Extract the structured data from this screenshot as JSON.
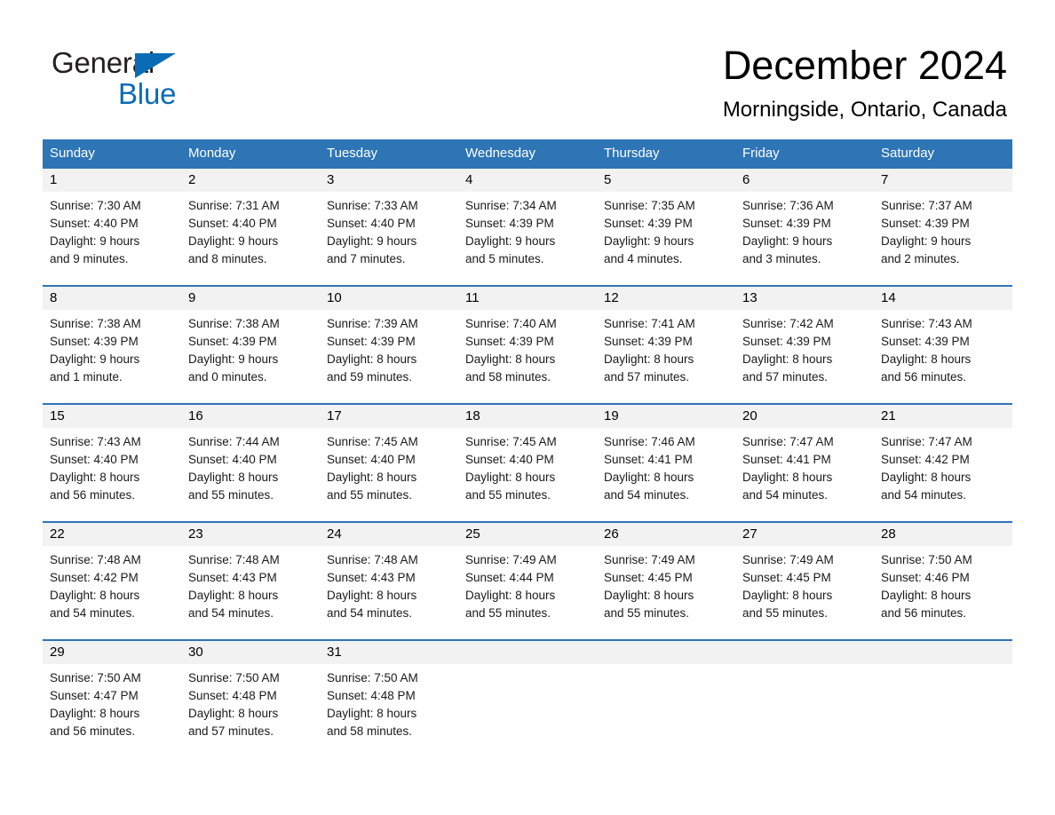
{
  "brand": {
    "name_part1": "General",
    "name_part2": "Blue",
    "accent_color": "#0a6cb4"
  },
  "header": {
    "title": "December 2024",
    "subtitle": "Morningside, Ontario, Canada"
  },
  "theme": {
    "header_bar_color": "#2e75b6",
    "day_band_color": "#f2f2f2",
    "text_color": "#000000"
  },
  "weekdays": [
    "Sunday",
    "Monday",
    "Tuesday",
    "Wednesday",
    "Thursday",
    "Friday",
    "Saturday"
  ],
  "weeks": [
    [
      {
        "day": "1",
        "sunrise": "Sunrise: 7:30 AM",
        "sunset": "Sunset: 4:40 PM",
        "daylight_line1": "Daylight: 9 hours",
        "daylight_line2": "and 9 minutes."
      },
      {
        "day": "2",
        "sunrise": "Sunrise: 7:31 AM",
        "sunset": "Sunset: 4:40 PM",
        "daylight_line1": "Daylight: 9 hours",
        "daylight_line2": "and 8 minutes."
      },
      {
        "day": "3",
        "sunrise": "Sunrise: 7:33 AM",
        "sunset": "Sunset: 4:40 PM",
        "daylight_line1": "Daylight: 9 hours",
        "daylight_line2": "and 7 minutes."
      },
      {
        "day": "4",
        "sunrise": "Sunrise: 7:34 AM",
        "sunset": "Sunset: 4:39 PM",
        "daylight_line1": "Daylight: 9 hours",
        "daylight_line2": "and 5 minutes."
      },
      {
        "day": "5",
        "sunrise": "Sunrise: 7:35 AM",
        "sunset": "Sunset: 4:39 PM",
        "daylight_line1": "Daylight: 9 hours",
        "daylight_line2": "and 4 minutes."
      },
      {
        "day": "6",
        "sunrise": "Sunrise: 7:36 AM",
        "sunset": "Sunset: 4:39 PM",
        "daylight_line1": "Daylight: 9 hours",
        "daylight_line2": "and 3 minutes."
      },
      {
        "day": "7",
        "sunrise": "Sunrise: 7:37 AM",
        "sunset": "Sunset: 4:39 PM",
        "daylight_line1": "Daylight: 9 hours",
        "daylight_line2": "and 2 minutes."
      }
    ],
    [
      {
        "day": "8",
        "sunrise": "Sunrise: 7:38 AM",
        "sunset": "Sunset: 4:39 PM",
        "daylight_line1": "Daylight: 9 hours",
        "daylight_line2": "and 1 minute."
      },
      {
        "day": "9",
        "sunrise": "Sunrise: 7:38 AM",
        "sunset": "Sunset: 4:39 PM",
        "daylight_line1": "Daylight: 9 hours",
        "daylight_line2": "and 0 minutes."
      },
      {
        "day": "10",
        "sunrise": "Sunrise: 7:39 AM",
        "sunset": "Sunset: 4:39 PM",
        "daylight_line1": "Daylight: 8 hours",
        "daylight_line2": "and 59 minutes."
      },
      {
        "day": "11",
        "sunrise": "Sunrise: 7:40 AM",
        "sunset": "Sunset: 4:39 PM",
        "daylight_line1": "Daylight: 8 hours",
        "daylight_line2": "and 58 minutes."
      },
      {
        "day": "12",
        "sunrise": "Sunrise: 7:41 AM",
        "sunset": "Sunset: 4:39 PM",
        "daylight_line1": "Daylight: 8 hours",
        "daylight_line2": "and 57 minutes."
      },
      {
        "day": "13",
        "sunrise": "Sunrise: 7:42 AM",
        "sunset": "Sunset: 4:39 PM",
        "daylight_line1": "Daylight: 8 hours",
        "daylight_line2": "and 57 minutes."
      },
      {
        "day": "14",
        "sunrise": "Sunrise: 7:43 AM",
        "sunset": "Sunset: 4:39 PM",
        "daylight_line1": "Daylight: 8 hours",
        "daylight_line2": "and 56 minutes."
      }
    ],
    [
      {
        "day": "15",
        "sunrise": "Sunrise: 7:43 AM",
        "sunset": "Sunset: 4:40 PM",
        "daylight_line1": "Daylight: 8 hours",
        "daylight_line2": "and 56 minutes."
      },
      {
        "day": "16",
        "sunrise": "Sunrise: 7:44 AM",
        "sunset": "Sunset: 4:40 PM",
        "daylight_line1": "Daylight: 8 hours",
        "daylight_line2": "and 55 minutes."
      },
      {
        "day": "17",
        "sunrise": "Sunrise: 7:45 AM",
        "sunset": "Sunset: 4:40 PM",
        "daylight_line1": "Daylight: 8 hours",
        "daylight_line2": "and 55 minutes."
      },
      {
        "day": "18",
        "sunrise": "Sunrise: 7:45 AM",
        "sunset": "Sunset: 4:40 PM",
        "daylight_line1": "Daylight: 8 hours",
        "daylight_line2": "and 55 minutes."
      },
      {
        "day": "19",
        "sunrise": "Sunrise: 7:46 AM",
        "sunset": "Sunset: 4:41 PM",
        "daylight_line1": "Daylight: 8 hours",
        "daylight_line2": "and 54 minutes."
      },
      {
        "day": "20",
        "sunrise": "Sunrise: 7:47 AM",
        "sunset": "Sunset: 4:41 PM",
        "daylight_line1": "Daylight: 8 hours",
        "daylight_line2": "and 54 minutes."
      },
      {
        "day": "21",
        "sunrise": "Sunrise: 7:47 AM",
        "sunset": "Sunset: 4:42 PM",
        "daylight_line1": "Daylight: 8 hours",
        "daylight_line2": "and 54 minutes."
      }
    ],
    [
      {
        "day": "22",
        "sunrise": "Sunrise: 7:48 AM",
        "sunset": "Sunset: 4:42 PM",
        "daylight_line1": "Daylight: 8 hours",
        "daylight_line2": "and 54 minutes."
      },
      {
        "day": "23",
        "sunrise": "Sunrise: 7:48 AM",
        "sunset": "Sunset: 4:43 PM",
        "daylight_line1": "Daylight: 8 hours",
        "daylight_line2": "and 54 minutes."
      },
      {
        "day": "24",
        "sunrise": "Sunrise: 7:48 AM",
        "sunset": "Sunset: 4:43 PM",
        "daylight_line1": "Daylight: 8 hours",
        "daylight_line2": "and 54 minutes."
      },
      {
        "day": "25",
        "sunrise": "Sunrise: 7:49 AM",
        "sunset": "Sunset: 4:44 PM",
        "daylight_line1": "Daylight: 8 hours",
        "daylight_line2": "and 55 minutes."
      },
      {
        "day": "26",
        "sunrise": "Sunrise: 7:49 AM",
        "sunset": "Sunset: 4:45 PM",
        "daylight_line1": "Daylight: 8 hours",
        "daylight_line2": "and 55 minutes."
      },
      {
        "day": "27",
        "sunrise": "Sunrise: 7:49 AM",
        "sunset": "Sunset: 4:45 PM",
        "daylight_line1": "Daylight: 8 hours",
        "daylight_line2": "and 55 minutes."
      },
      {
        "day": "28",
        "sunrise": "Sunrise: 7:50 AM",
        "sunset": "Sunset: 4:46 PM",
        "daylight_line1": "Daylight: 8 hours",
        "daylight_line2": "and 56 minutes."
      }
    ],
    [
      {
        "day": "29",
        "sunrise": "Sunrise: 7:50 AM",
        "sunset": "Sunset: 4:47 PM",
        "daylight_line1": "Daylight: 8 hours",
        "daylight_line2": "and 56 minutes."
      },
      {
        "day": "30",
        "sunrise": "Sunrise: 7:50 AM",
        "sunset": "Sunset: 4:48 PM",
        "daylight_line1": "Daylight: 8 hours",
        "daylight_line2": "and 57 minutes."
      },
      {
        "day": "31",
        "sunrise": "Sunrise: 7:50 AM",
        "sunset": "Sunset: 4:48 PM",
        "daylight_line1": "Daylight: 8 hours",
        "daylight_line2": "and 58 minutes."
      },
      {
        "day": "",
        "sunrise": "",
        "sunset": "",
        "daylight_line1": "",
        "daylight_line2": ""
      },
      {
        "day": "",
        "sunrise": "",
        "sunset": "",
        "daylight_line1": "",
        "daylight_line2": ""
      },
      {
        "day": "",
        "sunrise": "",
        "sunset": "",
        "daylight_line1": "",
        "daylight_line2": ""
      },
      {
        "day": "",
        "sunrise": "",
        "sunset": "",
        "daylight_line1": "",
        "daylight_line2": ""
      }
    ]
  ]
}
